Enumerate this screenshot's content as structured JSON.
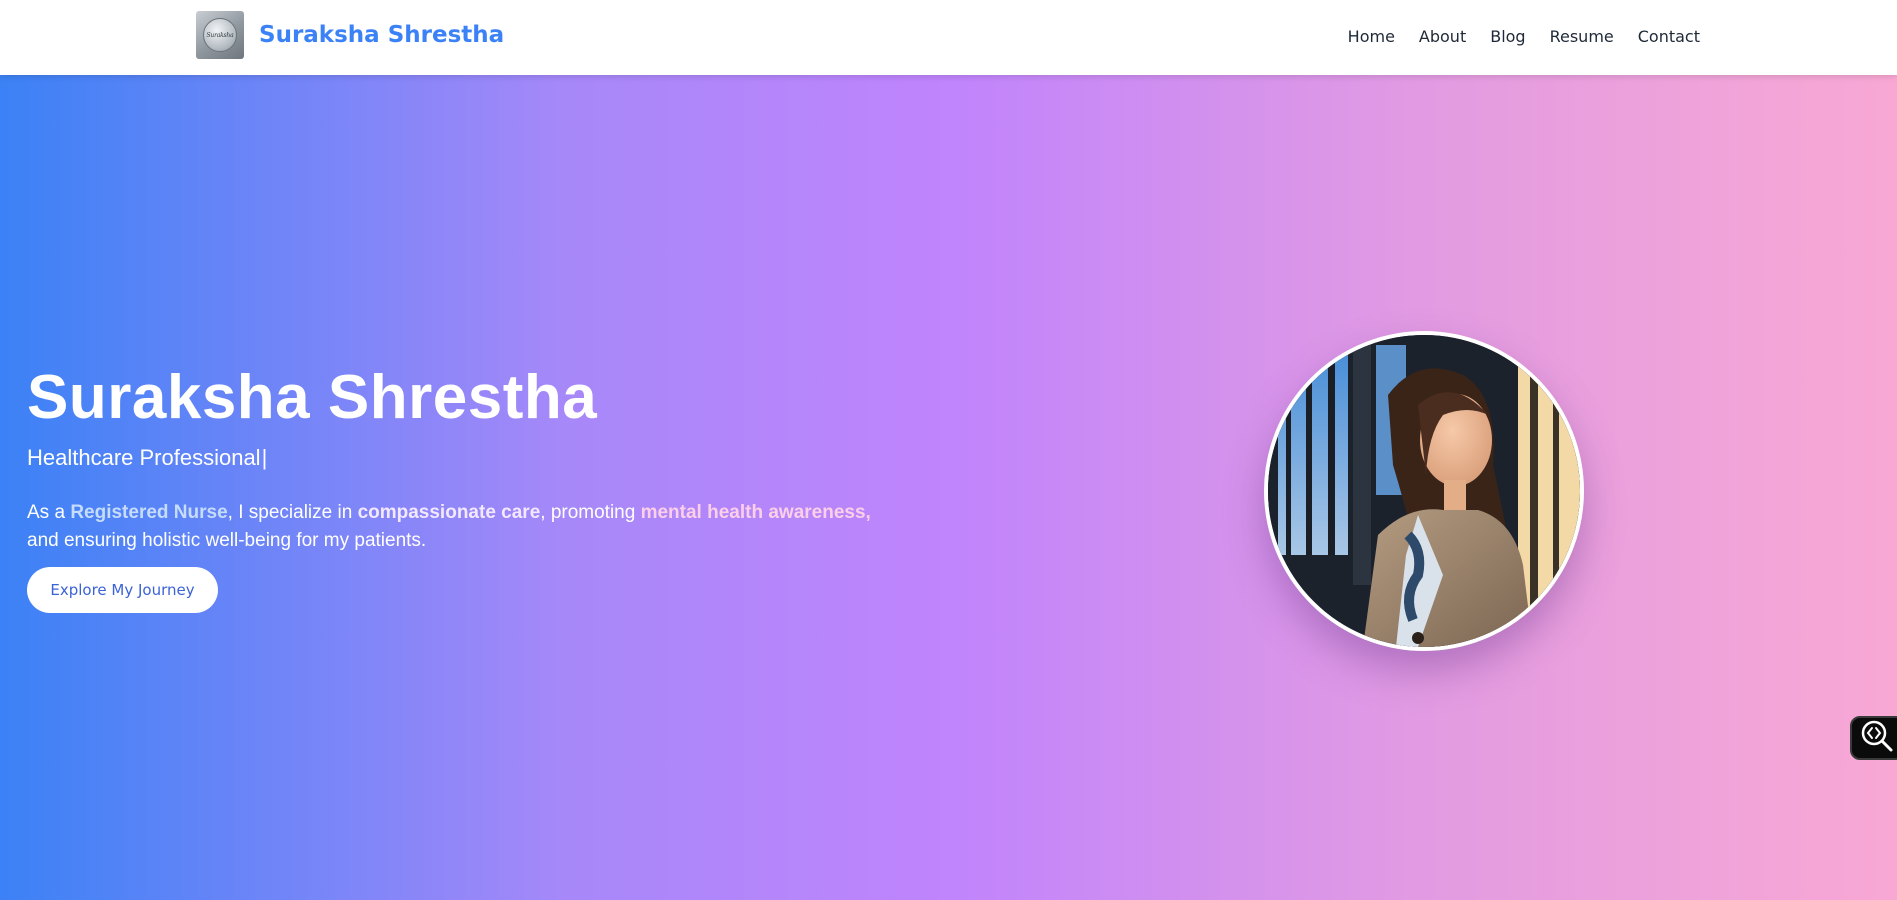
{
  "nav": {
    "brand_name": "Suraksha Shrestha",
    "logo_text": "Suraksha",
    "links": [
      "Home",
      "About",
      "Blog",
      "Resume",
      "Contact"
    ]
  },
  "hero": {
    "title": "Suraksha Shrestha",
    "role": "Healthcare Professional",
    "cursor": "|",
    "desc": {
      "p1": "As a ",
      "h1": "Registered Nurse",
      "p2": ", I specialize in ",
      "h2": "compassionate care",
      "p3": ", promoting ",
      "h3": "mental health awareness",
      "p4": ",",
      "p5": " and ensuring holistic well-being for my patients."
    },
    "cta_label": "Explore My Journey"
  },
  "icons": {
    "portrait": "profile-photo",
    "widget": "code-search-icon"
  },
  "colors": {
    "brand": "#3b82f6",
    "gradient_start": "#3b82f6",
    "gradient_mid": "#c084fc",
    "gradient_end": "#f9a8d4"
  }
}
